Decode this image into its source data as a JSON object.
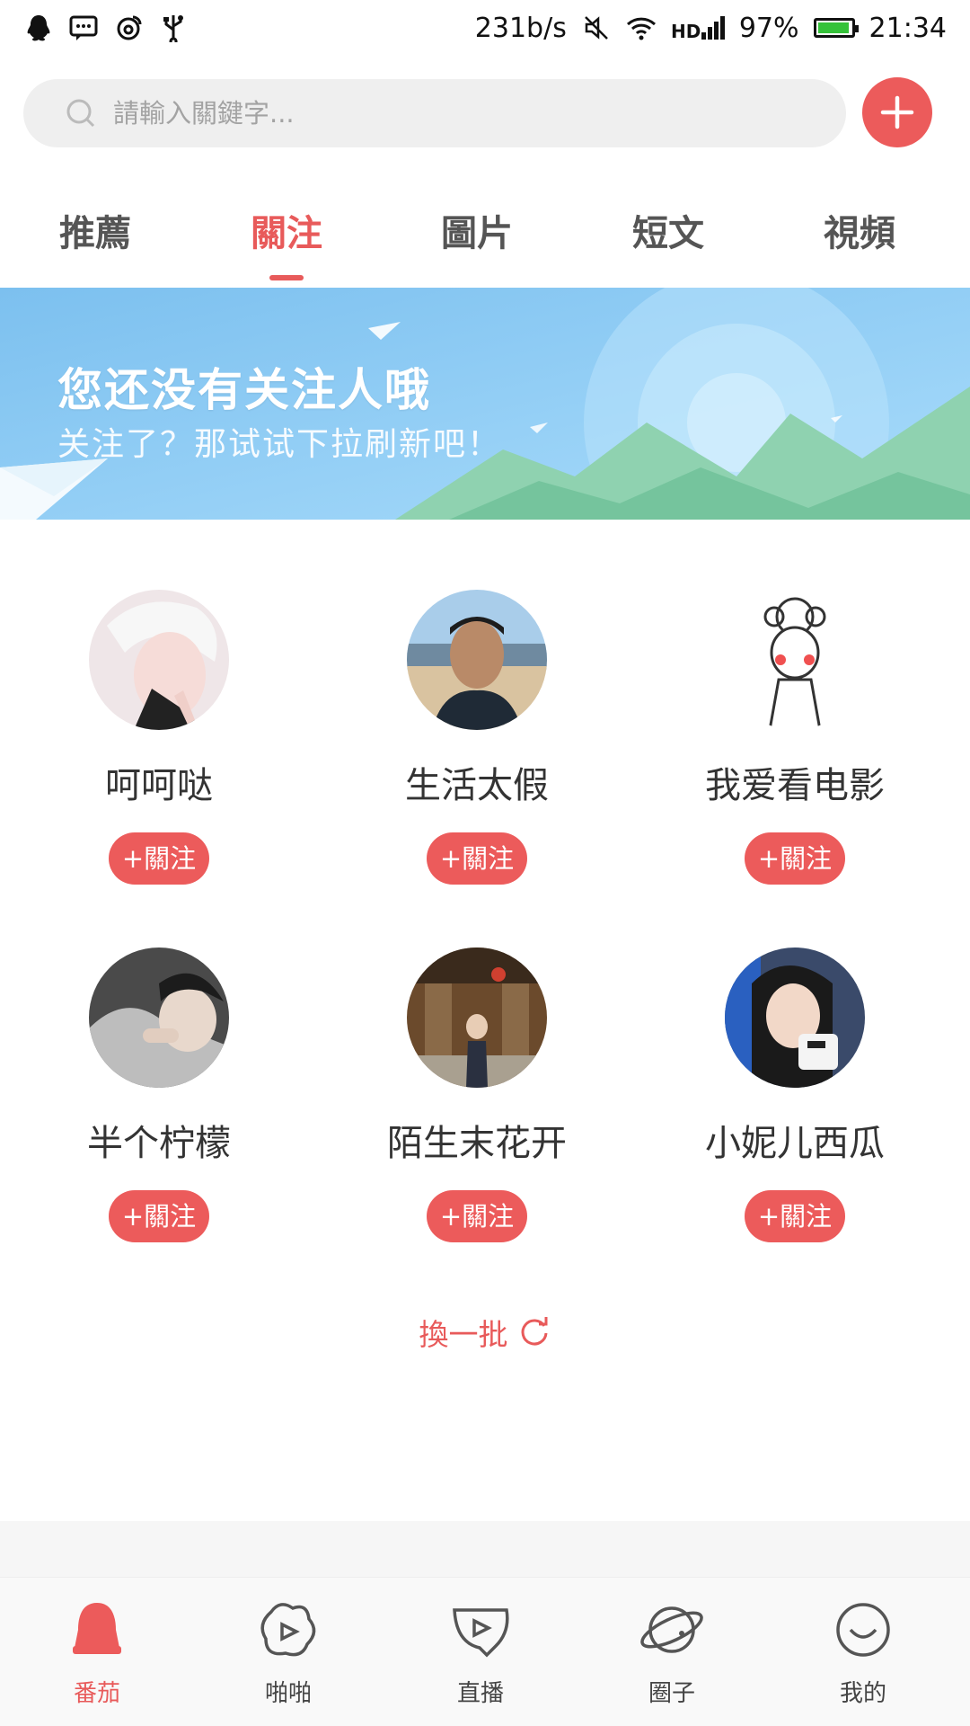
{
  "status_bar": {
    "net_speed": "231b/s",
    "battery_percent": "97%",
    "battery_level": 0.97,
    "time": "21:34",
    "icons": [
      "qq-icon",
      "message-icon",
      "weibo-icon",
      "usb-icon",
      "mute-icon",
      "wifi-icon",
      "hd-icon",
      "signal-icon",
      "battery-icon"
    ]
  },
  "search": {
    "placeholder": "請輸入關鍵字..."
  },
  "tabs": [
    {
      "label": "推薦",
      "active": false
    },
    {
      "label": "關注",
      "active": true
    },
    {
      "label": "圖片",
      "active": false
    },
    {
      "label": "短文",
      "active": false
    },
    {
      "label": "視頻",
      "active": false
    }
  ],
  "banner": {
    "title": "您还没有关注人哦",
    "subtitle": "关注了？那试试下拉刷新吧！"
  },
  "users": [
    {
      "name": "呵呵哒",
      "follow_label": "+關注"
    },
    {
      "name": "生活太假",
      "follow_label": "+關注"
    },
    {
      "name": "我爱看电影",
      "follow_label": "+關注"
    },
    {
      "name": "半个柠檬",
      "follow_label": "+關注"
    },
    {
      "name": "陌生末花开",
      "follow_label": "+關注"
    },
    {
      "name": "小妮儿西瓜",
      "follow_label": "+關注"
    }
  ],
  "refresh_label": "換一批",
  "bottom_nav": [
    {
      "label": "番茄",
      "icon": "bell-icon",
      "active": true
    },
    {
      "label": "啪啪",
      "icon": "video-blob-icon",
      "active": false
    },
    {
      "label": "直播",
      "icon": "live-play-icon",
      "active": false
    },
    {
      "label": "圈子",
      "icon": "planet-icon",
      "active": false
    },
    {
      "label": "我的",
      "icon": "smile-icon",
      "active": false
    }
  ],
  "colors": {
    "accent": "#e85a5a",
    "button": "#ec5b5b",
    "banner_sky": "#8fc8f2",
    "banner_mountain": "#8fd2b0"
  }
}
